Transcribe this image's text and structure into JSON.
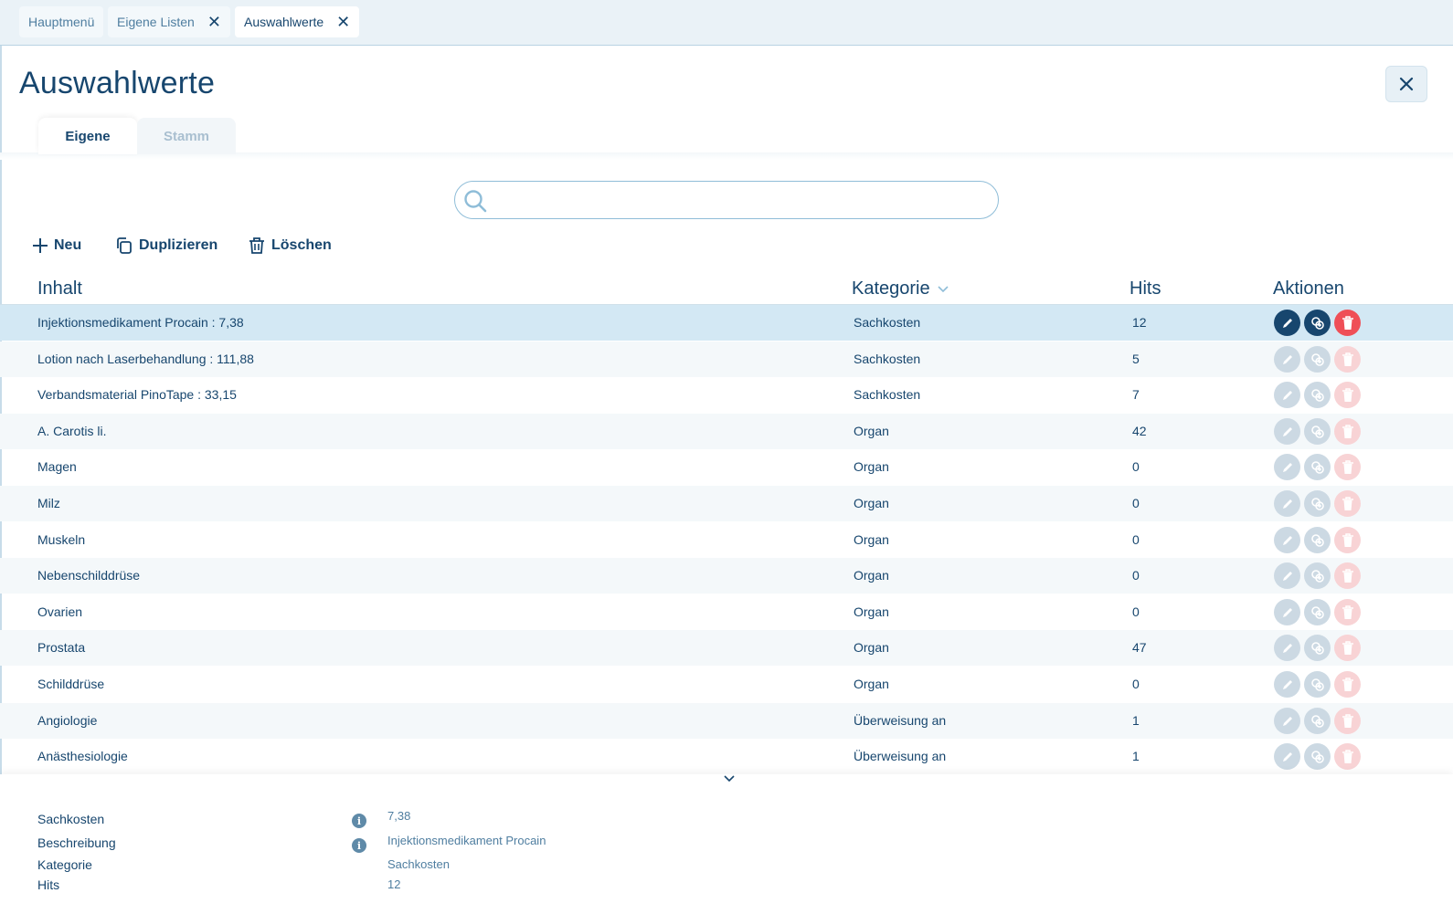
{
  "tabs": [
    {
      "label": "Hauptmenü"
    },
    {
      "label": "Eigene Listen"
    },
    {
      "label": "Auswahlwerte"
    }
  ],
  "page_title": "Auswahlwerte",
  "content_tabs": [
    {
      "label": "Eigene"
    },
    {
      "label": "Stamm"
    }
  ],
  "search": {
    "value": "",
    "placeholder": ""
  },
  "toolbar": {
    "new_label": "Neu",
    "duplicate_label": "Duplizieren",
    "delete_label": "Löschen"
  },
  "table": {
    "headers": {
      "content": "Inhalt",
      "category": "Kategorie",
      "hits": "Hits",
      "actions": "Aktionen"
    },
    "rows": [
      {
        "content": "Injektionsmedikament Procain  : 7,38",
        "category": "Sachkosten",
        "hits": "12"
      },
      {
        "content": "Lotion nach Laserbehandlung : 111,88",
        "category": "Sachkosten",
        "hits": "5"
      },
      {
        "content": "Verbandsmaterial PinoTape : 33,15",
        "category": "Sachkosten",
        "hits": "7"
      },
      {
        "content": "A. Carotis li.",
        "category": "Organ",
        "hits": "42"
      },
      {
        "content": "Magen",
        "category": "Organ",
        "hits": "0"
      },
      {
        "content": "Milz",
        "category": "Organ",
        "hits": "0"
      },
      {
        "content": "Muskeln",
        "category": "Organ",
        "hits": "0"
      },
      {
        "content": "Nebenschilddrüse",
        "category": "Organ",
        "hits": "0"
      },
      {
        "content": "Ovarien",
        "category": "Organ",
        "hits": "0"
      },
      {
        "content": "Prostata",
        "category": "Organ",
        "hits": "47"
      },
      {
        "content": "Schilddrüse",
        "category": "Organ",
        "hits": "0"
      },
      {
        "content": "Angiologie",
        "category": "Überweisung an",
        "hits": "1"
      },
      {
        "content": "Anästhesiologie",
        "category": "Überweisung an",
        "hits": "1"
      }
    ]
  },
  "detail": {
    "fields": [
      {
        "label": "Sachkosten",
        "value": "7,38"
      },
      {
        "label": "Beschreibung",
        "value": "Injektionsmedikament Procain"
      },
      {
        "label": "Kategorie",
        "value": "Sachkosten"
      },
      {
        "label": "Hits",
        "value": "12"
      }
    ]
  },
  "colors": {
    "primary": "#17466e",
    "selected_row": "#d3e8f4",
    "delete_red": "#ef4f57",
    "tabbar_bg": "#eaf2f7"
  },
  "icons": {
    "search": "search-icon",
    "close": "close-icon",
    "new": "plus-icon",
    "duplicate": "copy-icon",
    "delete": "trash-icon",
    "edit": "pencil-icon",
    "sort": "chevron-down-icon",
    "info": "info-icon"
  }
}
